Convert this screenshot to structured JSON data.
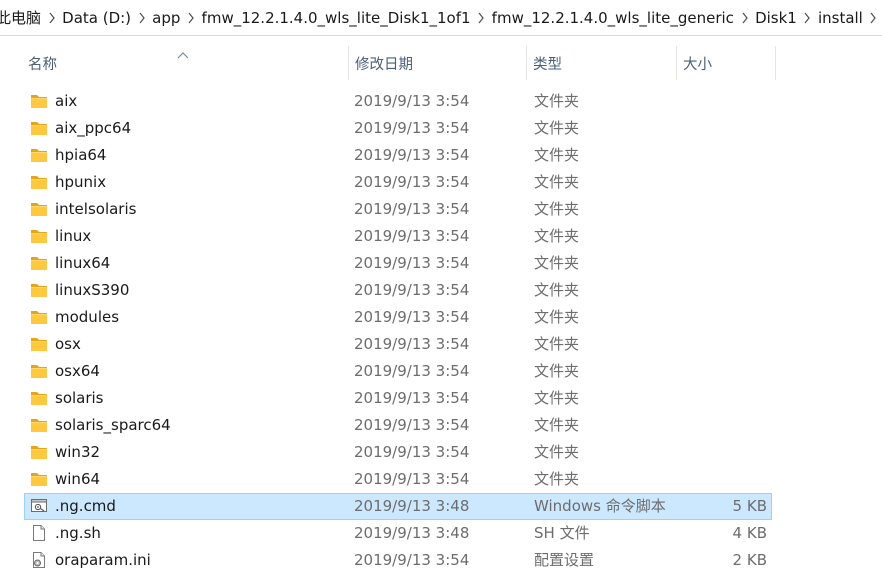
{
  "breadcrumb": [
    {
      "label": "此电脑"
    },
    {
      "label": "Data (D:)"
    },
    {
      "label": "app"
    },
    {
      "label": "fmw_12.2.1.4.0_wls_lite_Disk1_1of1"
    },
    {
      "label": "fmw_12.2.1.4.0_wls_lite_generic"
    },
    {
      "label": "Disk1"
    },
    {
      "label": "install"
    }
  ],
  "columns": {
    "name": "名称",
    "date": "修改日期",
    "type": "类型",
    "size": "大小",
    "sorted_by": "name",
    "sort_direction": "ascending"
  },
  "colors": {
    "folder": "#ffc83d",
    "folder_dark": "#e8a317",
    "selection_bg": "#cce8ff",
    "selection_border": "#99d1ff",
    "header_text": "#4c607a",
    "secondary_text": "#6d6d6d"
  },
  "files": [
    {
      "name": "aix",
      "date": "2019/9/13 3:54",
      "type": "文件夹",
      "size": "",
      "icon": "folder-icon",
      "selected": false
    },
    {
      "name": "aix_ppc64",
      "date": "2019/9/13 3:54",
      "type": "文件夹",
      "size": "",
      "icon": "folder-icon",
      "selected": false
    },
    {
      "name": "hpia64",
      "date": "2019/9/13 3:54",
      "type": "文件夹",
      "size": "",
      "icon": "folder-icon",
      "selected": false
    },
    {
      "name": "hpunix",
      "date": "2019/9/13 3:54",
      "type": "文件夹",
      "size": "",
      "icon": "folder-icon",
      "selected": false
    },
    {
      "name": "intelsolaris",
      "date": "2019/9/13 3:54",
      "type": "文件夹",
      "size": "",
      "icon": "folder-icon",
      "selected": false
    },
    {
      "name": "linux",
      "date": "2019/9/13 3:54",
      "type": "文件夹",
      "size": "",
      "icon": "folder-icon",
      "selected": false
    },
    {
      "name": "linux64",
      "date": "2019/9/13 3:54",
      "type": "文件夹",
      "size": "",
      "icon": "folder-icon",
      "selected": false
    },
    {
      "name": "linuxS390",
      "date": "2019/9/13 3:54",
      "type": "文件夹",
      "size": "",
      "icon": "folder-icon",
      "selected": false
    },
    {
      "name": "modules",
      "date": "2019/9/13 3:54",
      "type": "文件夹",
      "size": "",
      "icon": "folder-icon",
      "selected": false
    },
    {
      "name": "osx",
      "date": "2019/9/13 3:54",
      "type": "文件夹",
      "size": "",
      "icon": "folder-icon",
      "selected": false
    },
    {
      "name": "osx64",
      "date": "2019/9/13 3:54",
      "type": "文件夹",
      "size": "",
      "icon": "folder-icon",
      "selected": false
    },
    {
      "name": "solaris",
      "date": "2019/9/13 3:54",
      "type": "文件夹",
      "size": "",
      "icon": "folder-icon",
      "selected": false
    },
    {
      "name": "solaris_sparc64",
      "date": "2019/9/13 3:54",
      "type": "文件夹",
      "size": "",
      "icon": "folder-icon",
      "selected": false
    },
    {
      "name": "win32",
      "date": "2019/9/13 3:54",
      "type": "文件夹",
      "size": "",
      "icon": "folder-icon",
      "selected": false
    },
    {
      "name": "win64",
      "date": "2019/9/13 3:54",
      "type": "文件夹",
      "size": "",
      "icon": "folder-icon",
      "selected": false
    },
    {
      "name": ".ng.cmd",
      "date": "2019/9/13 3:48",
      "type": "Windows 命令脚本",
      "size": "5 KB",
      "icon": "cmd-script-icon",
      "selected": true
    },
    {
      "name": ".ng.sh",
      "date": "2019/9/13 3:48",
      "type": "SH 文件",
      "size": "4 KB",
      "icon": "file-icon",
      "selected": false
    },
    {
      "name": "oraparam.ini",
      "date": "2019/9/13 3:54",
      "type": "配置设置",
      "size": "2 KB",
      "icon": "settings-file-icon",
      "selected": false
    }
  ]
}
